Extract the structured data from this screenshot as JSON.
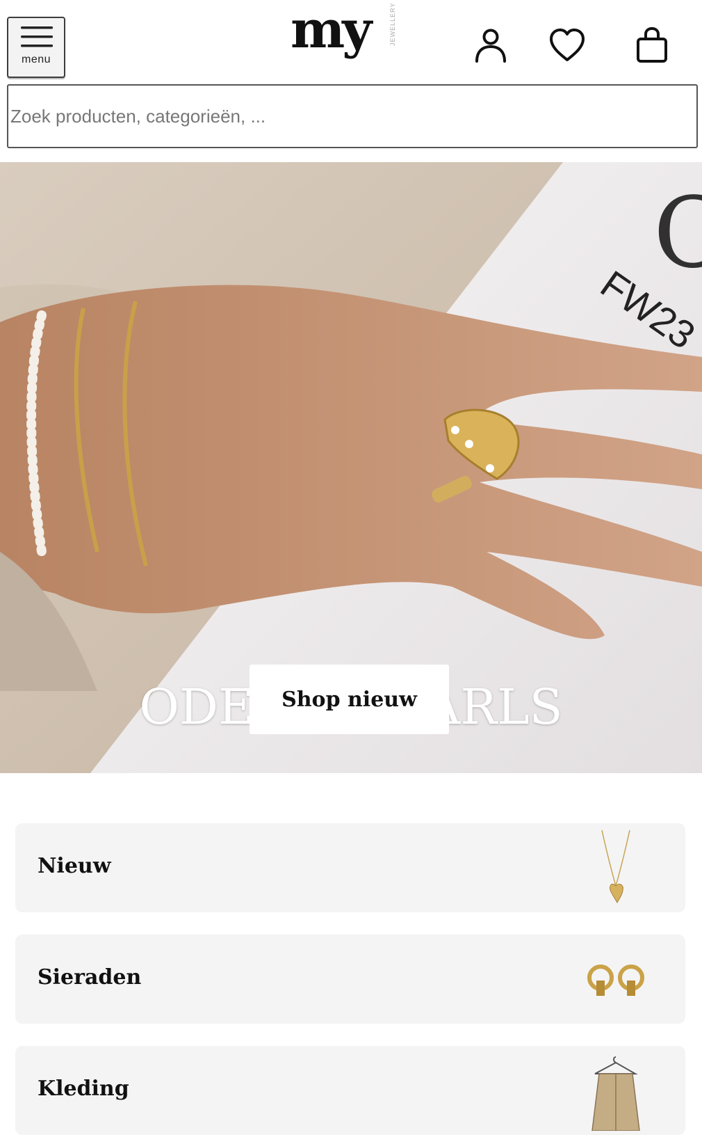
{
  "header": {
    "menu_label": "menu",
    "logo_text": "my",
    "logo_subtext": "JEWELLERY",
    "icons": [
      "account-icon",
      "wishlist-heart-icon",
      "shopping-bag-icon"
    ]
  },
  "search": {
    "placeholder": "Zoek producten, categorieën, ..."
  },
  "hero": {
    "title": "ODE TO PEARLS",
    "button_label": "Shop nieuw",
    "background_text": "FW23"
  },
  "categories": [
    {
      "label": "Nieuw",
      "thumbnail": "heart-necklace"
    },
    {
      "label": "Sieraden",
      "thumbnail": "gold-hoop-earrings"
    },
    {
      "label": "Kleding",
      "thumbnail": "jacket-on-hanger"
    }
  ],
  "colors": {
    "accent_button_bg": "#ffffff",
    "category_bg": "#f4f4f4",
    "text": "#111111"
  }
}
